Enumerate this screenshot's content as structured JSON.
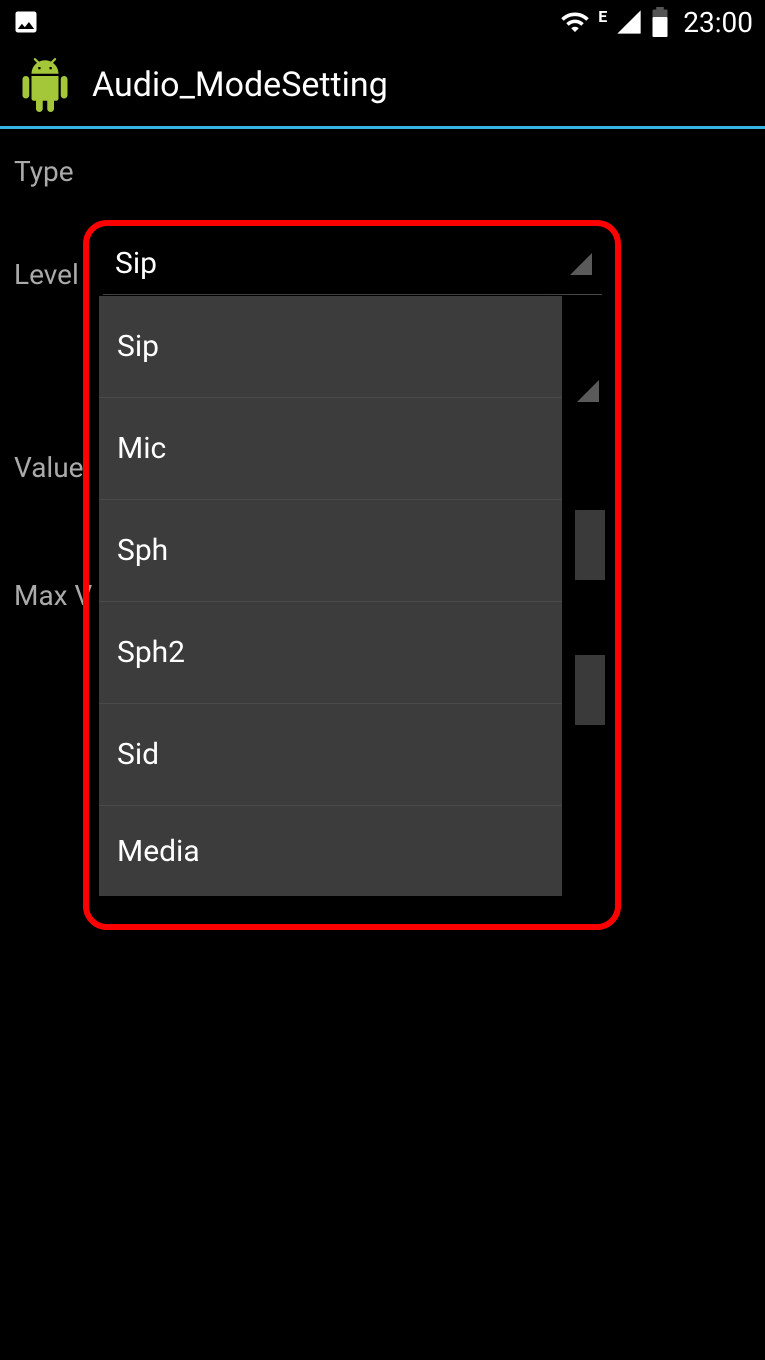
{
  "status_bar": {
    "clock": "23:00",
    "network_type": "E"
  },
  "action_bar": {
    "title": "Audio_ModeSetting"
  },
  "labels": {
    "type": "Type",
    "level": "Level",
    "value": "Value",
    "max_v": "Max V"
  },
  "spinner": {
    "selected": "Sip",
    "options": [
      "Sip",
      "Mic",
      "Sph",
      "Sph2",
      "Sid",
      "Media"
    ]
  }
}
